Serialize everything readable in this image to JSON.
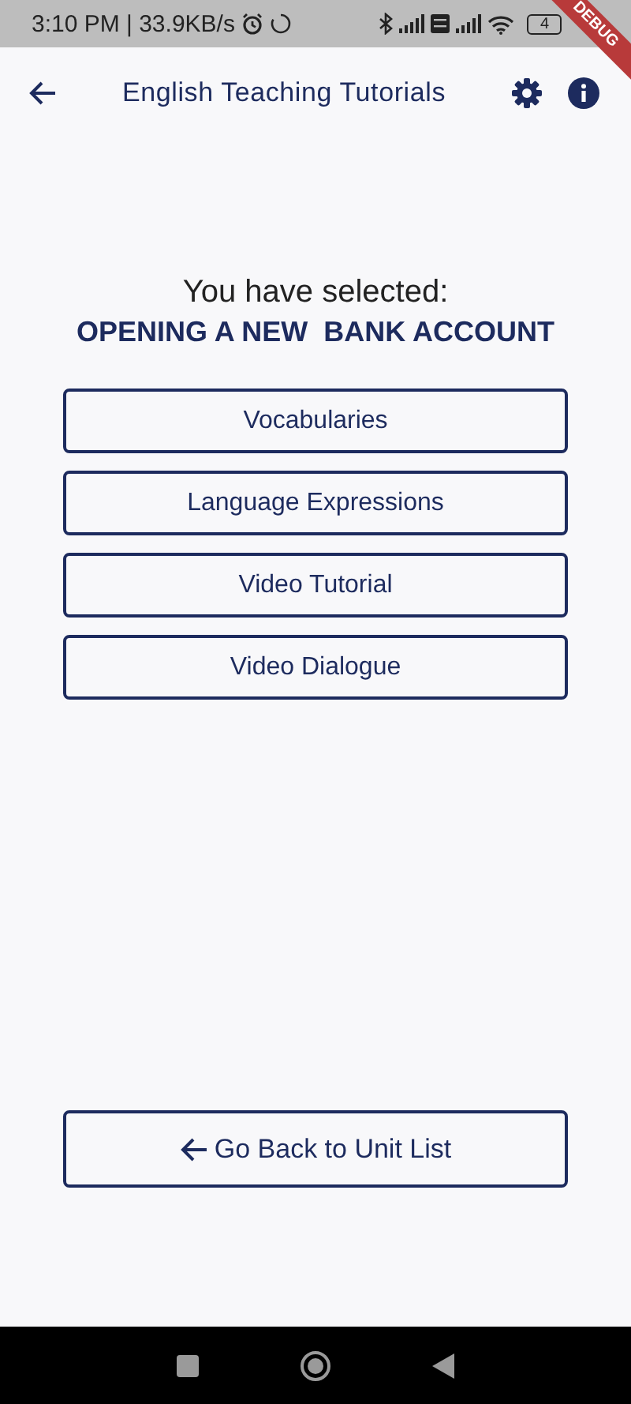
{
  "status_bar": {
    "time": "3:10 PM | 33.9KB/s",
    "battery": "4"
  },
  "debug_banner": "DEBUG",
  "app_bar": {
    "title": "English Teaching Tutorials"
  },
  "selection": {
    "prompt": "You have selected:",
    "unit": "OPENING A NEW  BANK ACCOUNT"
  },
  "options": [
    {
      "label": "Vocabularies"
    },
    {
      "label": "Language Expressions"
    },
    {
      "label": "Video Tutorial"
    },
    {
      "label": "Video Dialogue"
    }
  ],
  "back_button": {
    "label": "Go Back to Unit List"
  }
}
